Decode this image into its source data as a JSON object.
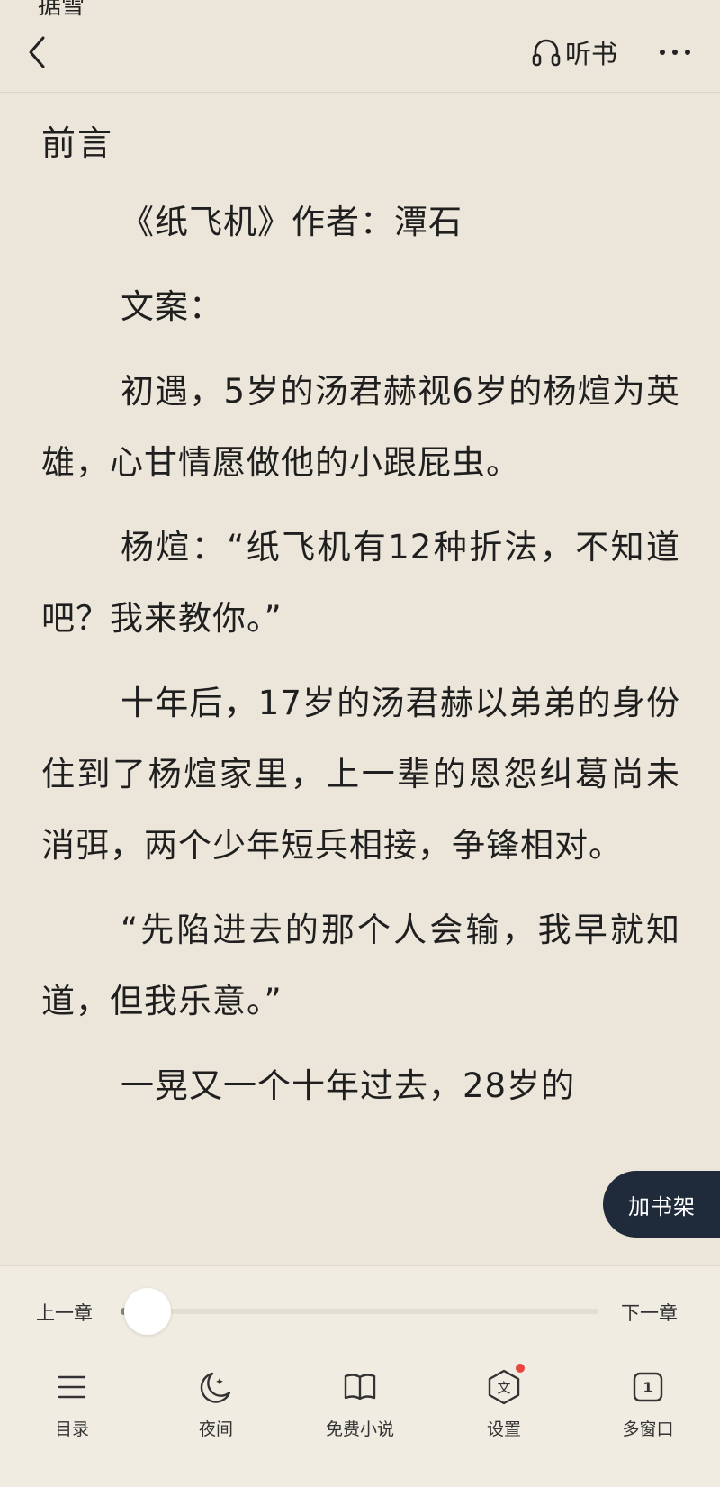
{
  "status": {
    "fragment": "据雪"
  },
  "header": {
    "back_icon": "chevron-left-icon",
    "listen_label": "听书",
    "listen_icon": "headphones-icon",
    "more_icon": "more-horizontal-icon"
  },
  "chapter": {
    "title": "前言",
    "paragraphs": [
      "《纸飞机》作者：潭石",
      "文案：",
      "初遇，5岁的汤君赫视6岁的杨煊为英雄，心甘情愿做他的小跟屁虫。",
      "杨煊：“纸飞机有12种折法，不知道吧？我来教你。”",
      "十年后，17岁的汤君赫以弟弟的身份住到了杨煊家里，上一辈的恩怨纠葛尚未消弭，两个少年短兵相接，争锋相对。",
      "“先陷进去的那个人会输，我早就知道，但我乐意。”",
      "一晃又一个十年过去，28岁的"
    ]
  },
  "add_shelf_button": "加书架",
  "progress": {
    "prev_label": "上一章",
    "next_label": "下一章",
    "value": 0.0
  },
  "bottom_nav": [
    {
      "label": "目录",
      "icon": "menu-lines-icon"
    },
    {
      "label": "夜间",
      "icon": "moon-icon"
    },
    {
      "label": "免费小说",
      "icon": "open-book-icon"
    },
    {
      "label": "设置",
      "icon": "settings-hexagon-icon",
      "has_badge": true
    },
    {
      "label": "多窗口",
      "icon": "window-number-icon",
      "icon_text": "1"
    }
  ],
  "colors": {
    "page_background": "#ebe6d9",
    "text": "#1f1f1f",
    "shelf_button": "#1f2a3a",
    "badge": "#e8453c"
  }
}
